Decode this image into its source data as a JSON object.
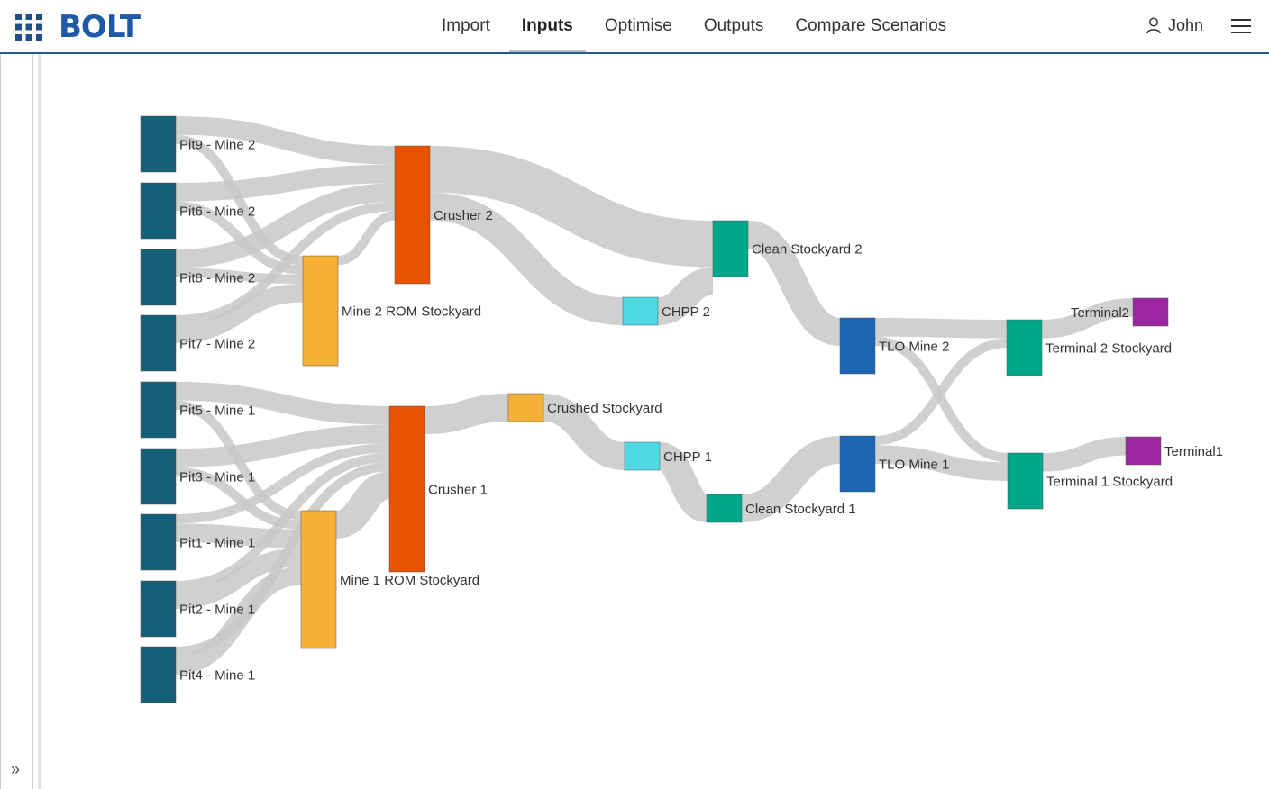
{
  "app": {
    "logo": "BOLT"
  },
  "nav": {
    "tabs": [
      {
        "label": "Import",
        "active": false
      },
      {
        "label": "Inputs",
        "active": true
      },
      {
        "label": "Optimise",
        "active": false
      },
      {
        "label": "Outputs",
        "active": false
      },
      {
        "label": "Compare Scenarios",
        "active": false
      }
    ]
  },
  "user": {
    "name": "John"
  },
  "icons": {
    "apps": "apps-grid-icon",
    "user": "user-icon",
    "menu": "hamburger-menu-icon",
    "expand": "double-chevron-right-icon"
  },
  "colors": {
    "accent": "#1f5a94",
    "pit": "#155f78",
    "stockyard": "#f7b136",
    "crusher": "#e65200",
    "chpp": "#4dd8e3",
    "clean": "#00a88a",
    "tlo": "#1e66b4",
    "terminal": "#9c27a0",
    "link": "#c8c8c8"
  },
  "chart_data": {
    "type": "sankey",
    "nodes": [
      {
        "id": "pit9",
        "label": "Pit9 - Mine 2",
        "kind": "pit"
      },
      {
        "id": "pit6",
        "label": "Pit6 - Mine 2",
        "kind": "pit"
      },
      {
        "id": "pit8",
        "label": "Pit8 - Mine 2",
        "kind": "pit"
      },
      {
        "id": "pit7",
        "label": "Pit7 - Mine 2",
        "kind": "pit"
      },
      {
        "id": "pit5",
        "label": "Pit5 - Mine 1",
        "kind": "pit"
      },
      {
        "id": "pit3",
        "label": "Pit3 - Mine 1",
        "kind": "pit"
      },
      {
        "id": "pit1",
        "label": "Pit1 - Mine 1",
        "kind": "pit"
      },
      {
        "id": "pit2",
        "label": "Pit2 - Mine 1",
        "kind": "pit"
      },
      {
        "id": "pit4",
        "label": "Pit4 - Mine 1",
        "kind": "pit"
      },
      {
        "id": "m2rom",
        "label": "Mine 2 ROM Stockyard",
        "kind": "stockyard"
      },
      {
        "id": "m1rom",
        "label": "Mine 1 ROM Stockyard",
        "kind": "stockyard"
      },
      {
        "id": "crusher2",
        "label": "Crusher 2",
        "kind": "crusher"
      },
      {
        "id": "crusher1",
        "label": "Crusher 1",
        "kind": "crusher"
      },
      {
        "id": "crushedsy",
        "label": "Crushed Stockyard",
        "kind": "stockyard"
      },
      {
        "id": "chpp2",
        "label": "CHPP 2",
        "kind": "chpp"
      },
      {
        "id": "chpp1",
        "label": "CHPP 1",
        "kind": "chpp"
      },
      {
        "id": "clean2",
        "label": "Clean Stockyard 2",
        "kind": "clean"
      },
      {
        "id": "clean1",
        "label": "Clean Stockyard 1",
        "kind": "clean"
      },
      {
        "id": "tlo2",
        "label": "TLO Mine 2",
        "kind": "tlo"
      },
      {
        "id": "tlo1",
        "label": "TLO Mine 1",
        "kind": "tlo"
      },
      {
        "id": "t2sy",
        "label": "Terminal 2 Stockyard",
        "kind": "clean"
      },
      {
        "id": "t1sy",
        "label": "Terminal 1 Stockyard",
        "kind": "clean"
      },
      {
        "id": "terminal2",
        "label": "Terminal2",
        "kind": "terminal"
      },
      {
        "id": "terminal1",
        "label": "Terminal1",
        "kind": "terminal"
      }
    ],
    "links": [
      {
        "source": "pit9",
        "target": "crusher2",
        "value": 2
      },
      {
        "source": "pit9",
        "target": "m2rom",
        "value": 1
      },
      {
        "source": "pit6",
        "target": "crusher2",
        "value": 2
      },
      {
        "source": "pit6",
        "target": "m2rom",
        "value": 1
      },
      {
        "source": "pit8",
        "target": "crusher2",
        "value": 2
      },
      {
        "source": "pit8",
        "target": "m2rom",
        "value": 1
      },
      {
        "source": "pit7",
        "target": "crusher2",
        "value": 1
      },
      {
        "source": "pit7",
        "target": "m2rom",
        "value": 2
      },
      {
        "source": "m2rom",
        "target": "crusher2",
        "value": 1
      },
      {
        "source": "crusher2",
        "target": "clean2",
        "value": 5
      },
      {
        "source": "crusher2",
        "target": "chpp2",
        "value": 3
      },
      {
        "source": "chpp2",
        "target": "clean2",
        "value": 3
      },
      {
        "source": "clean2",
        "target": "tlo2",
        "value": 3
      },
      {
        "source": "pit5",
        "target": "crusher1",
        "value": 2
      },
      {
        "source": "pit5",
        "target": "m1rom",
        "value": 1
      },
      {
        "source": "pit3",
        "target": "crusher1",
        "value": 2
      },
      {
        "source": "pit3",
        "target": "m1rom",
        "value": 1
      },
      {
        "source": "pit1",
        "target": "crusher1",
        "value": 1
      },
      {
        "source": "pit1",
        "target": "m1rom",
        "value": 2
      },
      {
        "source": "pit2",
        "target": "crusher1",
        "value": 1
      },
      {
        "source": "pit2",
        "target": "m1rom",
        "value": 2
      },
      {
        "source": "pit4",
        "target": "crusher1",
        "value": 1
      },
      {
        "source": "pit4",
        "target": "m1rom",
        "value": 2
      },
      {
        "source": "m1rom",
        "target": "crusher1",
        "value": 3
      },
      {
        "source": "crusher1",
        "target": "crushedsy",
        "value": 3
      },
      {
        "source": "crushedsy",
        "target": "chpp1",
        "value": 3
      },
      {
        "source": "chpp1",
        "target": "clean1",
        "value": 3
      },
      {
        "source": "clean1",
        "target": "tlo1",
        "value": 3
      },
      {
        "source": "tlo2",
        "target": "t2sy",
        "value": 2
      },
      {
        "source": "tlo2",
        "target": "t1sy",
        "value": 1
      },
      {
        "source": "tlo1",
        "target": "t2sy",
        "value": 1
      },
      {
        "source": "tlo1",
        "target": "t1sy",
        "value": 2
      },
      {
        "source": "t2sy",
        "target": "terminal2",
        "value": 2
      },
      {
        "source": "t1sy",
        "target": "terminal1",
        "value": 2
      }
    ]
  }
}
